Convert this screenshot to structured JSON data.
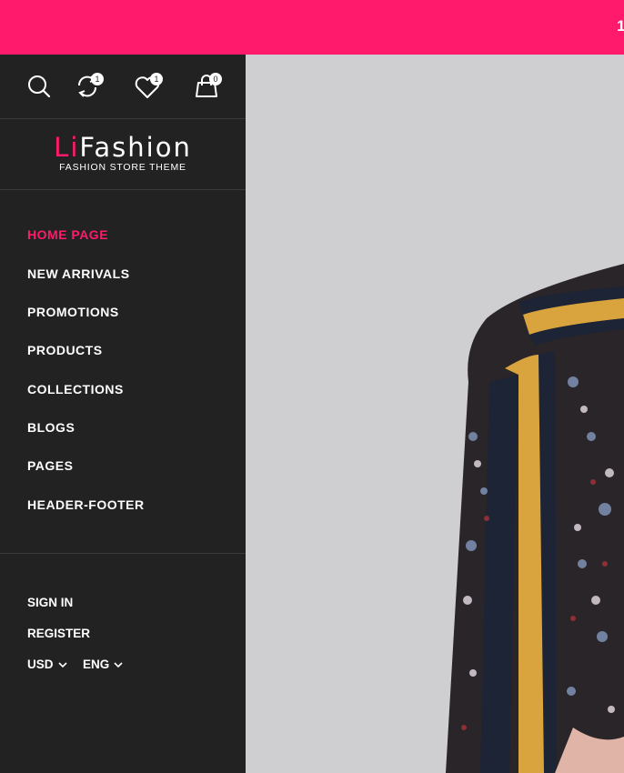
{
  "announcement": {
    "text": "1"
  },
  "header_icons": {
    "search": {
      "icon": "search-icon"
    },
    "compare": {
      "icon": "compare-icon",
      "count": "1"
    },
    "wishlist": {
      "icon": "heart-icon",
      "count": "1"
    },
    "cart": {
      "icon": "bag-icon",
      "count": "0"
    }
  },
  "logo": {
    "accent": "Li",
    "name": "Fashion",
    "tagline": "FASHION STORE THEME"
  },
  "nav": {
    "items": [
      {
        "label": "HOME PAGE",
        "active": true
      },
      {
        "label": "NEW ARRIVALS",
        "active": false
      },
      {
        "label": "PROMOTIONS",
        "active": false
      },
      {
        "label": "PRODUCTS",
        "active": false
      },
      {
        "label": "COLLECTIONS",
        "active": false
      },
      {
        "label": "BLOGS",
        "active": false
      },
      {
        "label": "PAGES",
        "active": false
      },
      {
        "label": "HEADER-FOOTER",
        "active": false
      }
    ]
  },
  "account": {
    "sign_in": "SIGN IN",
    "register": "REGISTER"
  },
  "selectors": {
    "currency": "USD",
    "language": "ENG"
  },
  "colors": {
    "accent": "#ff1a6c",
    "sidebar_bg": "#222222",
    "hero_bg": "#cfcfd2"
  }
}
